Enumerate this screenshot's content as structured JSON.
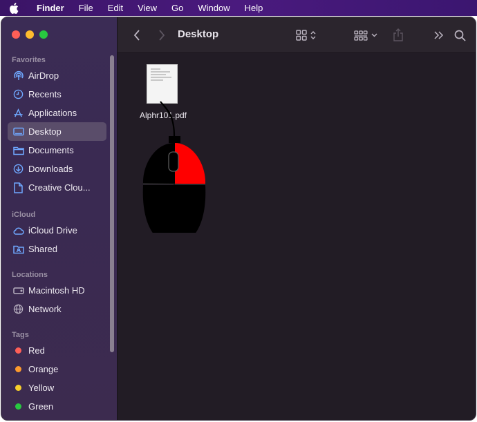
{
  "menubar": {
    "app_name": "Finder",
    "items": [
      "File",
      "Edit",
      "View",
      "Go",
      "Window",
      "Help"
    ]
  },
  "toolbar": {
    "title": "Desktop"
  },
  "sidebar": {
    "favorites_title": "Favorites",
    "favorites": [
      {
        "label": "AirDrop",
        "icon": "airdrop-icon"
      },
      {
        "label": "Recents",
        "icon": "clock-icon"
      },
      {
        "label": "Applications",
        "icon": "applications-icon"
      },
      {
        "label": "Desktop",
        "icon": "desktop-icon",
        "selected": true
      },
      {
        "label": "Documents",
        "icon": "document-icon"
      },
      {
        "label": "Downloads",
        "icon": "download-icon"
      },
      {
        "label": "Creative Clou...",
        "icon": "file-icon"
      }
    ],
    "icloud_title": "iCloud",
    "icloud": [
      {
        "label": "iCloud Drive",
        "icon": "cloud-icon"
      },
      {
        "label": "Shared",
        "icon": "shared-folder-icon"
      }
    ],
    "locations_title": "Locations",
    "locations": [
      {
        "label": "Macintosh HD",
        "icon": "disk-icon"
      },
      {
        "label": "Network",
        "icon": "globe-icon"
      }
    ],
    "tags_title": "Tags",
    "tags": [
      {
        "label": "Red",
        "color": "#fe5f57"
      },
      {
        "label": "Orange",
        "color": "#fd9a2d"
      },
      {
        "label": "Yellow",
        "color": "#f8cf2b"
      },
      {
        "label": "Green",
        "color": "#28c840"
      }
    ]
  },
  "files": [
    {
      "name": "Alphr101.pdf",
      "icon": "pdf-file-icon"
    }
  ],
  "colors": {
    "accent_mouse_button": "#ff0000"
  }
}
